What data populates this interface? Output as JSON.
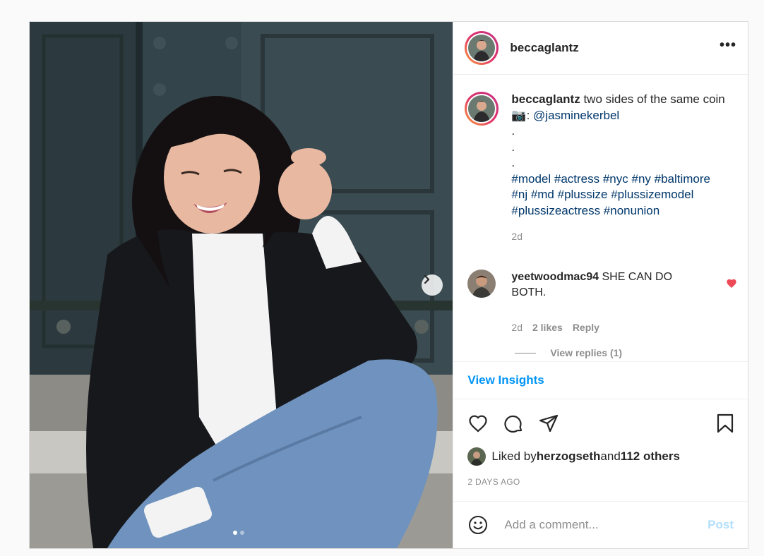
{
  "post": {
    "username": "beccaglantz",
    "more_label": "•••",
    "caption": {
      "username": "beccaglantz",
      "text": " two sides of the same coin",
      "camera_emoji": "📷",
      "credit_sep": ": ",
      "credit_mention": "@jasminekerbel",
      "dots": [
        ".",
        ".",
        "."
      ],
      "hashtags_line1": "#model #actress #nyc #ny #baltimore",
      "hashtags_line2": "#nj #md #plussize #plussizemodel",
      "hashtags_line3": "#plussizeactress #nonunion",
      "age": "2d"
    },
    "comment": {
      "username": "yeetwoodmac94",
      "text": " SHE CAN DO BOTH.",
      "age": "2d",
      "likes": "2 likes",
      "reply_label": "Reply",
      "view_replies": "View replies (1)"
    },
    "insights_label": "View Insights",
    "liked_by": {
      "prefix": "Liked by ",
      "user": "herzogseth",
      "middle": " and ",
      "others": "112 others"
    },
    "time_ago": "2 DAYS AGO",
    "add_comment_placeholder": "Add a comment...",
    "post_button": "Post"
  },
  "carousel": {
    "total_slides": 2,
    "current_slide": 1
  },
  "colors": {
    "link": "#00376b",
    "accent": "#0095f6",
    "heart": "#ed4956",
    "post_disabled": "#b2dffc"
  },
  "icons": {
    "more": "more-options-icon",
    "next": "chevron-right-icon",
    "like": "heart-icon",
    "comment": "comment-bubble-icon",
    "share": "paper-plane-icon",
    "save": "bookmark-icon",
    "emoji": "smiley-icon"
  }
}
